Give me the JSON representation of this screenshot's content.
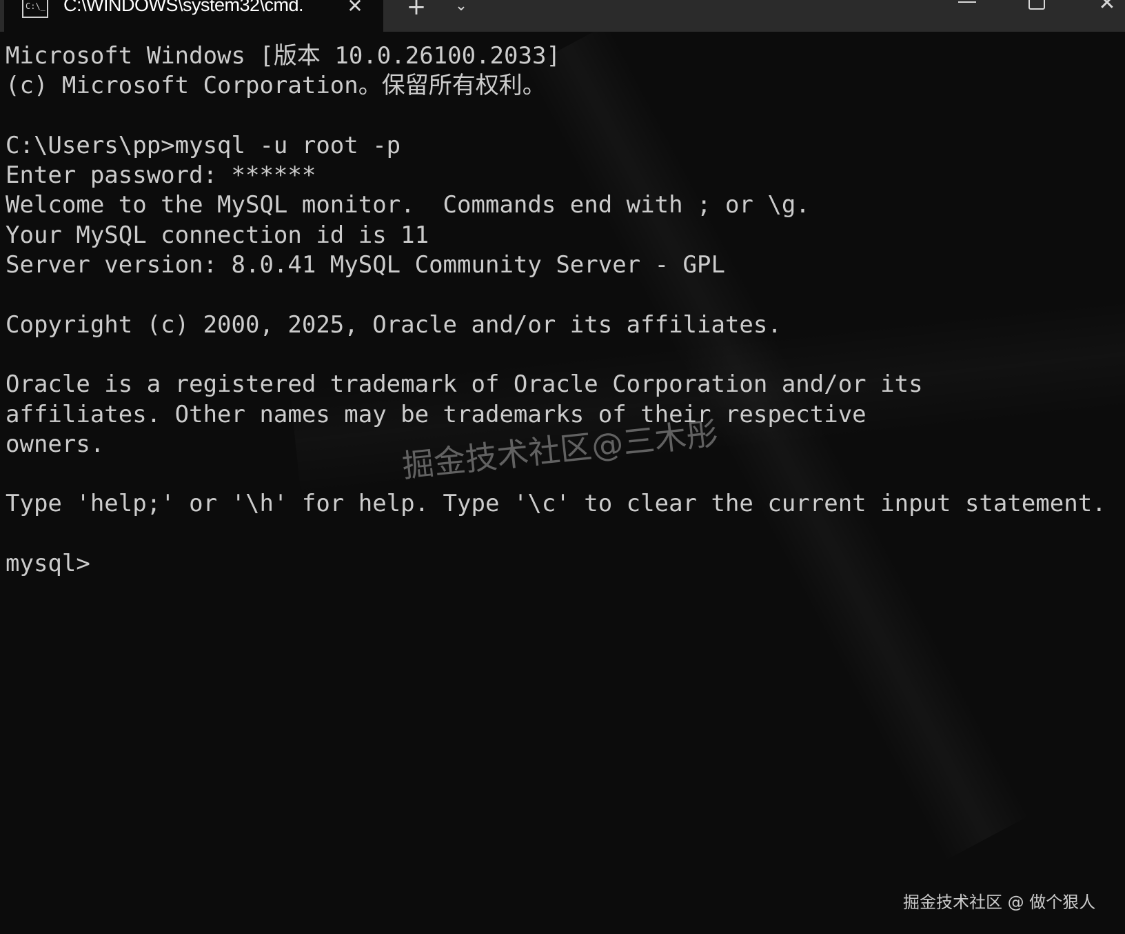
{
  "titlebar": {
    "tab_title": "C:\\WINDOWS\\system32\\cmd.",
    "tab_icon_text": "C:\\_",
    "tab_close_glyph": "✕",
    "new_tab_glyph": "+",
    "dropdown_glyph": "⌄",
    "window_close_glyph": "✕"
  },
  "console": {
    "lines": [
      "Microsoft Windows [版本 10.0.26100.2033]",
      "(c) Microsoft Corporation。保留所有权利。",
      "",
      "C:\\Users\\pp>mysql -u root -p",
      "Enter password: ******",
      "Welcome to the MySQL monitor.  Commands end with ; or \\g.",
      "Your MySQL connection id is 11",
      "Server version: 8.0.41 MySQL Community Server - GPL",
      "",
      "Copyright (c) 2000, 2025, Oracle and/or its affiliates.",
      "",
      "Oracle is a registered trademark of Oracle Corporation and/or its",
      "affiliates. Other names may be trademarks of their respective",
      "owners.",
      "",
      "Type 'help;' or '\\h' for help. Type '\\c' to clear the current input statement.",
      "",
      "mysql>"
    ]
  },
  "watermarks": {
    "center": "掘金技术社区@三木彤",
    "corner": "掘金技术社区 @ 做个狠人"
  },
  "colors": {
    "background": "#0c0c0c",
    "titlebar": "#2b2b2b",
    "text": "#cccccc"
  },
  "icons": {
    "tab_icon": "cmd-terminal-icon",
    "tab_close": "close-icon",
    "new_tab": "plus-icon",
    "dropdown": "chevron-down-icon",
    "minimize": "minimize-icon",
    "maximize": "maximize-icon",
    "window_close": "close-icon"
  }
}
